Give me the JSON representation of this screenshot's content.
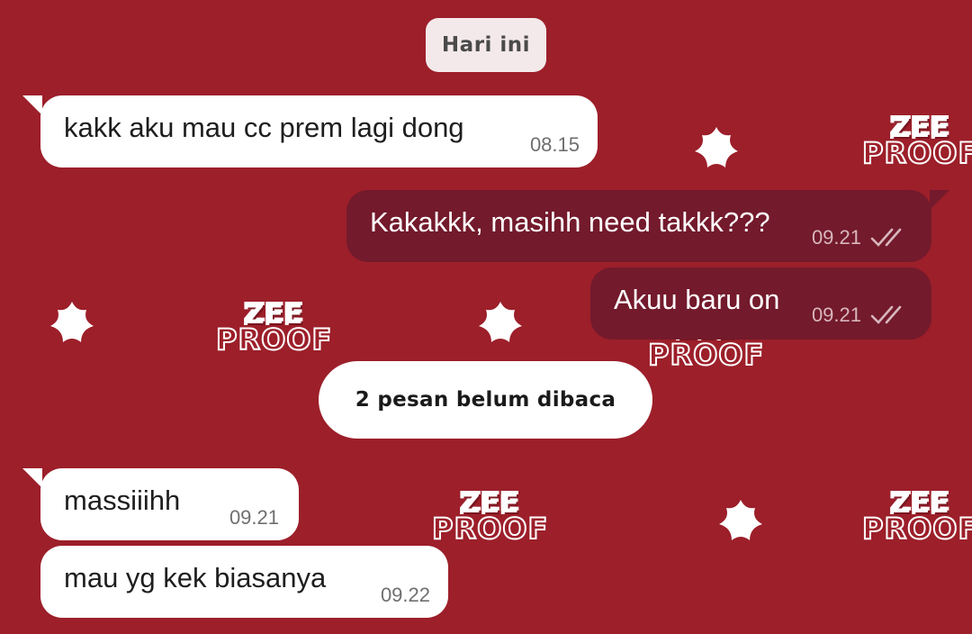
{
  "colors": {
    "background": "#9c1f2a",
    "incoming_bubble": "#ffffff",
    "outgoing_bubble": "#731a2c",
    "date_pill": "#f4e9ea"
  },
  "wallpaper": {
    "logo_line1": "ZEE",
    "logo_line2": "PROOF"
  },
  "date_divider": "Hari ini",
  "unread_divider": "2 pesan belum dibaca",
  "messages": [
    {
      "direction": "in",
      "text": "kakk aku mau cc prem lagi dong",
      "time": "08.15"
    },
    {
      "direction": "out",
      "text": "Kakakkk, masihh need takkk???",
      "time": "09.21",
      "status_icon": "double-check-icon"
    },
    {
      "direction": "out",
      "text": "Akuu baru on",
      "time": "09.21",
      "status_icon": "double-check-icon"
    },
    {
      "direction": "in",
      "text": "massiiihh",
      "time": "09.21"
    },
    {
      "direction": "in",
      "text": "mau yg kek biasanya",
      "time": "09.22"
    }
  ]
}
